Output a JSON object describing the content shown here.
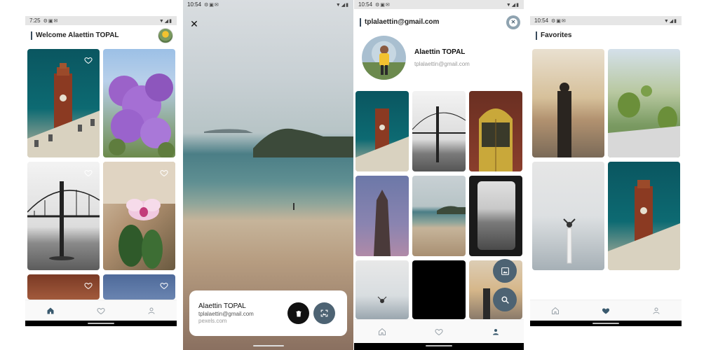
{
  "screen1": {
    "status_time": "7:25",
    "header_title": "Welcome Alaettin TOPAL",
    "nav": [
      "home-icon",
      "heart-icon",
      "person-icon"
    ]
  },
  "screen2": {
    "status_time": "10:54",
    "card": {
      "name": "Alaettin TOPAL",
      "email": "tplalaettin@gmail.com",
      "source": "pexels.com"
    }
  },
  "screen3": {
    "status_time": "10:54",
    "header_email": "tplalaettin@gmail.com",
    "profile_name": "Alaettin TOPAL",
    "profile_email": "tplalaettin@gmail.com"
  },
  "screen4": {
    "status_time": "10:54",
    "header_title": "Favorites"
  },
  "colors": {
    "accent": "#394b5c",
    "fab": "#4d6373",
    "nav_active": "#3a5a6e",
    "nav_inactive": "#9aa3aa"
  }
}
